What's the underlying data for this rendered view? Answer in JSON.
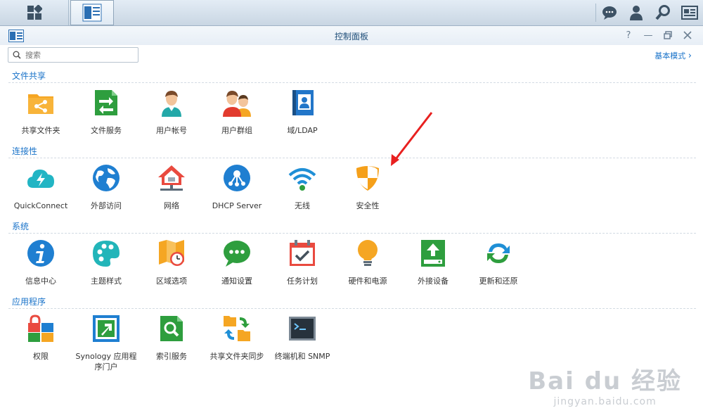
{
  "window": {
    "title": "控制面板"
  },
  "search": {
    "placeholder": "搜索"
  },
  "mode": {
    "label": "基本模式"
  },
  "sections": [
    {
      "title": "文件共享",
      "items": [
        "共享文件夹",
        "文件服务",
        "用户帐号",
        "用户群组",
        "域/LDAP"
      ]
    },
    {
      "title": "连接性",
      "items": [
        "QuickConnect",
        "外部访问",
        "网络",
        "DHCP Server",
        "无线",
        "安全性"
      ]
    },
    {
      "title": "系统",
      "items": [
        "信息中心",
        "主题样式",
        "区域选项",
        "通知设置",
        "任务计划",
        "硬件和电源",
        "外接设备",
        "更新和还原"
      ]
    },
    {
      "title": "应用程序",
      "items": [
        "权限",
        "Synology 应用程序门户",
        "索引服务",
        "共享文件夹同步",
        "终端机和 SNMP"
      ]
    }
  ],
  "watermark": {
    "main": "Bai du 经验",
    "sub": "jingyan.baidu.com"
  },
  "colors": {
    "accent": "#1a73c9",
    "arrow": "#e8201f"
  }
}
